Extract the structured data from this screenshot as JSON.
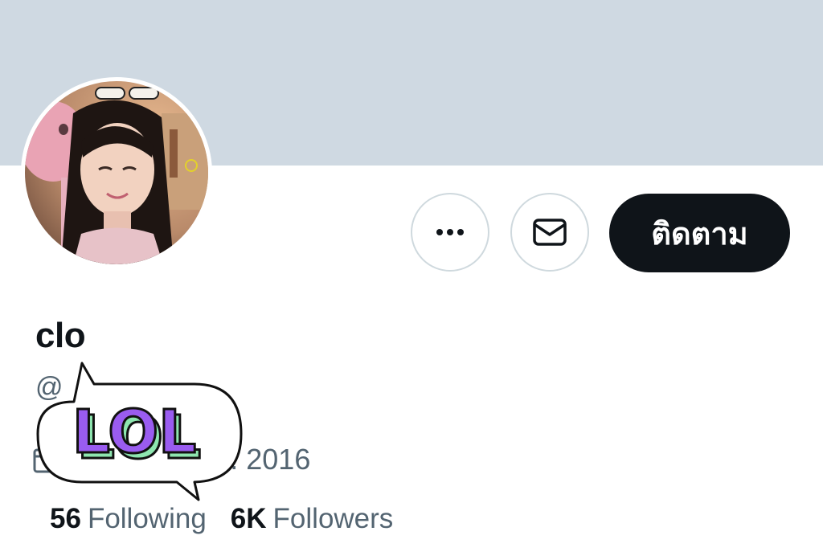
{
  "profile": {
    "display_name": "clo",
    "handle": "@",
    "joined": "สิงหาคม ค.ศ. 2016",
    "following_count": "56",
    "following_label": "Following",
    "followers_count": "6K",
    "followers_label": "Followers"
  },
  "actions": {
    "more_icon": "more-horizontal-icon",
    "message_icon": "envelope-icon",
    "follow_label": "ติดตาม"
  },
  "sticker": {
    "text": "LOL"
  },
  "colors": {
    "banner": "#cfd9e2",
    "primary_text": "#0f1419",
    "secondary_text": "#536471",
    "follow_button": "#0f1419",
    "sticker_purple": "#9a5cf0",
    "sticker_green": "#8ee6b0"
  }
}
